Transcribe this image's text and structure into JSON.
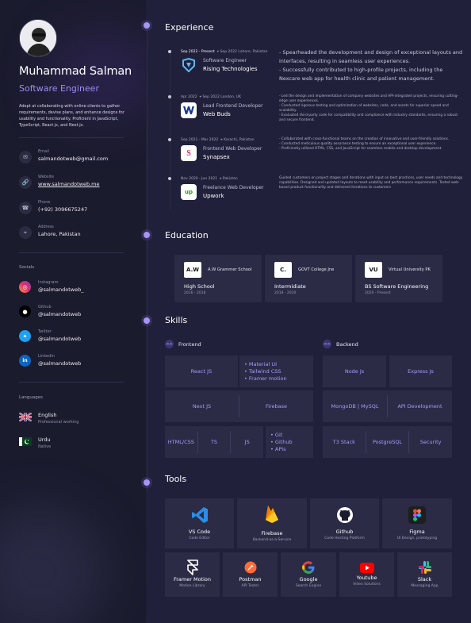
{
  "profile": {
    "name": "Muhammad Salman",
    "role": "Software Engineer",
    "about": "Adept at collaborating with online clients to gather requirements, devise plans, and enhance designs for usability and functionality. Proficient in JavaScript, TypeScript, React.js, and Next.js."
  },
  "contact": [
    {
      "label": "Email",
      "value": "salmandotweb@gmail.com",
      "icon": "mail-icon"
    },
    {
      "label": "Website",
      "value": "www.salmandotweb.me",
      "icon": "link-icon"
    },
    {
      "label": "Phone",
      "value": "(+92) 3096675247",
      "icon": "phone-icon"
    },
    {
      "label": "Address",
      "value": "Lahore, Pakistan",
      "icon": "location-icon"
    }
  ],
  "socials": {
    "heading": "Socials",
    "items": [
      {
        "label": "Instagram",
        "value": "@salmandotweb_",
        "icon": "instagram-icon",
        "color": "#e1306c"
      },
      {
        "label": "Github",
        "value": "@salmandotweb",
        "icon": "github-icon",
        "color": "#000000"
      },
      {
        "label": "Twitter",
        "value": "@salmandotweb",
        "icon": "twitter-icon",
        "color": "#1da1f2"
      },
      {
        "label": "Linkedin",
        "value": "@salmandotweb",
        "icon": "linkedin-icon",
        "color": "#0a66c2"
      }
    ]
  },
  "languages": {
    "heading": "Languages",
    "items": [
      {
        "name": "English",
        "level": "Professional working",
        "icon": "uk-flag-icon"
      },
      {
        "name": "Urdu",
        "level": "Native",
        "icon": "pakistan-flag-icon"
      }
    ]
  },
  "sections": {
    "experience": "Experience",
    "education": "Education",
    "skills": "Skills",
    "tools": "Tools"
  },
  "experience": [
    {
      "period": "Sep 2022 - Present",
      "location": "Sep 2022 Lahore, Pakistan",
      "title": "Software Engineer",
      "company": "Rising Technologies",
      "icon": "rising-technologies-logo-icon",
      "description": "- Spearheaded the development and design of exceptional layouts and interfaces, resulting in seamless user experiences.\n- Successfully contributed to high-profile projects, including the Nexcare web app for health clinic and patient management."
    },
    {
      "period": "Apr 2022",
      "location": "Sep 2022 London, UK",
      "title": "Lead Frontend Developer",
      "company": "Web Buds",
      "icon": "web-buds-logo-icon",
      "description": "- Led the design and implementation of company websites and API-integrated projects, ensuring cutting-edge user experiences.\n- Conducted rigorous testing and optimization of websites, code, and assets for superior speed and scalability.\n- Evaluated third-party code for compatibility and compliance with industry standards, ensuring a robust and secure frontend."
    },
    {
      "period": "Sep 2021 - Mar 2022",
      "location": "Karachi, Pakistan",
      "title": "Frontend Web Developer",
      "company": "Synapsex",
      "icon": "synapsex-logo-icon",
      "description": "- Collaborated with cross-functional teams on the creation of innovative and user-friendly solutions.\n- Conducted meticulous quality assurance testing to ensure an exceptional user experience.\n- Proficiently utilized HTML, CSS, and JavaScript for seamless mobile and desktop development."
    },
    {
      "period": "Nov 2020 - Jun 2021",
      "location": "Pakistan",
      "title": "Freelance Web Developer",
      "company": "Upwork",
      "icon": "upwork-logo-icon",
      "description": "Guided customers on project stages and iterations with input on best practices, user needs and technology capabilities. Designed and updated layouts to meet usability and performance requirements. Tested web-based product functionality and delivered iterations to customers"
    }
  ],
  "education": [
    {
      "badge": "A.W",
      "institution": "A.W Grammer School",
      "degree": "High School",
      "years": "2016 - 2018"
    },
    {
      "badge": "C.",
      "institution": "GOVT College Jrw",
      "degree": "Intermidiate",
      "years": "2018 - 2020"
    },
    {
      "badge": "VU",
      "institution": "Virtual University PK",
      "degree": "BS Software Engineering",
      "years": "2020 - Present"
    }
  ],
  "skills": {
    "frontend": {
      "heading": "Frontend",
      "react": "React JS",
      "react_extras": [
        "Material UI",
        "Tailwind CSS",
        "Framer motion"
      ],
      "next": "Next JS",
      "firebase": "Firebase",
      "html_css": "HTML/CSS",
      "ts": "TS",
      "js": "JS",
      "other": [
        "Git",
        "Github",
        "APIs"
      ]
    },
    "backend": {
      "heading": "Backend",
      "node": "Node Js",
      "express": "Express Js",
      "db": "MongoDB | MySQL",
      "api": "API Development",
      "t3": "T3 Stack",
      "postgres": "PostgreSQL",
      "security": "Security"
    }
  },
  "tools": [
    {
      "name": "VS Code",
      "sub": "Code Editor",
      "icon": "vscode-icon"
    },
    {
      "name": "Firebase",
      "sub": "Backend-as-a-Service",
      "icon": "firebase-icon"
    },
    {
      "name": "Github",
      "sub": "Code Hosting Platform",
      "icon": "github-icon"
    },
    {
      "name": "Figma",
      "sub": "UI Design, prototyping",
      "icon": "figma-icon"
    },
    {
      "name": "Framer Motion",
      "sub": "Motion Library",
      "icon": "framer-icon"
    },
    {
      "name": "Postman",
      "sub": "API Tester",
      "icon": "postman-icon"
    },
    {
      "name": "Google",
      "sub": "Search Engine",
      "icon": "google-icon"
    },
    {
      "name": "Youtube",
      "sub": "Video Solutions",
      "icon": "youtube-icon"
    },
    {
      "name": "Slack",
      "sub": "Messaging App",
      "icon": "slack-icon"
    }
  ],
  "colors": {
    "accent": "#a694f6",
    "background": "#20203a",
    "sidebar": "#1b1b2e",
    "card": "#2b2b46"
  }
}
